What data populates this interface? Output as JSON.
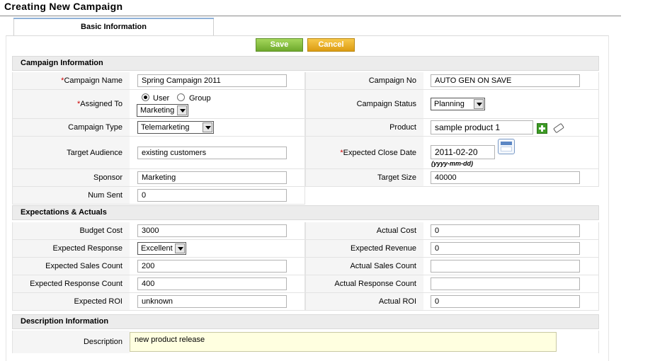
{
  "page": {
    "title": "Creating New Campaign",
    "tab_label": "Basic Information",
    "save_label": "Save",
    "cancel_label": "Cancel",
    "required_marker": "*"
  },
  "sections": {
    "campaign_info": "Campaign Information",
    "expectations": "Expectations & Actuals",
    "description": "Description Information"
  },
  "campaign": {
    "name_label": "Campaign Name",
    "name_value": "Spring Campaign 2011",
    "no_label": "Campaign No",
    "no_value": "AUTO GEN ON SAVE",
    "assigned_label": "Assigned To",
    "assigned_user_option": "User",
    "assigned_group_option": "Group",
    "assigned_selected": "User",
    "assigned_value": "Marketing",
    "status_label": "Campaign Status",
    "status_value": "Planning",
    "type_label": "Campaign Type",
    "type_value": "Telemarketing",
    "product_label": "Product",
    "product_value": "sample product 1",
    "audience_label": "Target Audience",
    "audience_value": "existing customers",
    "close_date_label": "Expected Close Date",
    "close_date_value": "2011-02-20",
    "date_format_hint": "(yyyy-mm-dd)",
    "sponsor_label": "Sponsor",
    "sponsor_value": "Marketing",
    "target_size_label": "Target Size",
    "target_size_value": "40000",
    "num_sent_label": "Num Sent",
    "num_sent_value": "0"
  },
  "expectations": {
    "budget_cost_label": "Budget Cost",
    "budget_cost_value": "3000",
    "actual_cost_label": "Actual Cost",
    "actual_cost_value": "0",
    "exp_response_label": "Expected Response",
    "exp_response_value": "Excellent",
    "exp_revenue_label": "Expected Revenue",
    "exp_revenue_value": "0",
    "exp_sales_count_label": "Expected Sales Count",
    "exp_sales_count_value": "200",
    "act_sales_count_label": "Actual Sales Count",
    "act_sales_count_value": "",
    "exp_response_count_label": "Expected Response Count",
    "exp_response_count_value": "400",
    "act_response_count_label": "Actual Response Count",
    "act_response_count_value": "",
    "exp_roi_label": "Expected ROI",
    "exp_roi_value": "unknown",
    "act_roi_label": "Actual ROI",
    "act_roi_value": "0"
  },
  "description": {
    "label": "Description",
    "value": "new product release"
  },
  "icons": {
    "add": "plus-icon",
    "clear": "eraser-icon",
    "calendar": "calendar-icon"
  }
}
